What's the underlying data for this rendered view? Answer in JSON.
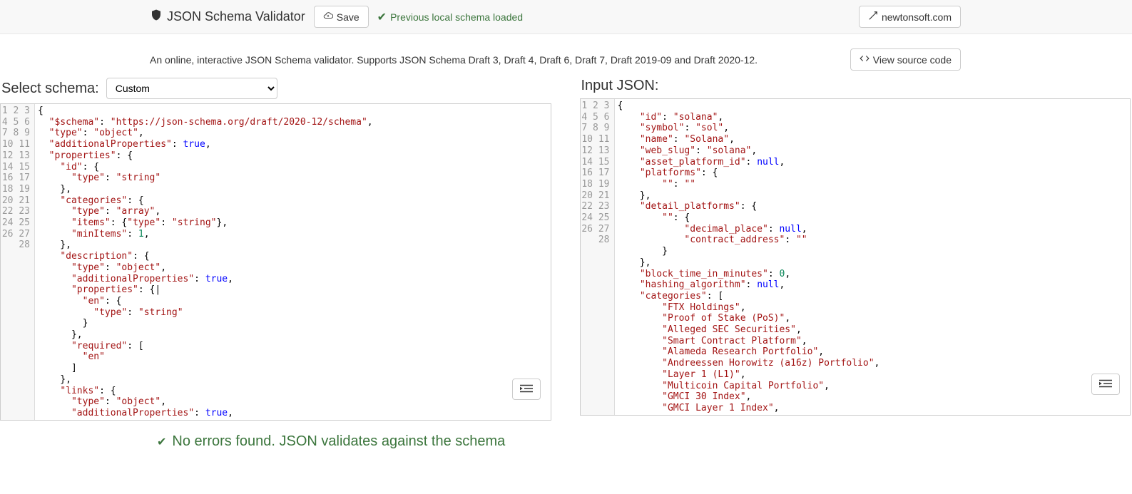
{
  "header": {
    "title": "JSON Schema Validator",
    "save_label": "Save",
    "status_loaded": "Previous local schema loaded",
    "newtonsoft_label": "newtonsoft.com"
  },
  "subheader": {
    "description": "An online, interactive JSON Schema validator. Supports JSON Schema Draft 3, Draft 4, Draft 6, Draft 7, Draft 2019-09 and Draft 2020-12.",
    "view_source_label": "View source code"
  },
  "left_panel": {
    "label": "Select schema:",
    "select_value": "Custom",
    "lines": [
      [
        [
          "punc",
          "{"
        ]
      ],
      [
        [
          "punc",
          "  "
        ],
        [
          "key",
          "\"$schema\""
        ],
        [
          "punc",
          ": "
        ],
        [
          "str",
          "\"https://json-schema.org/draft/2020-12/schema\""
        ],
        [
          "punc",
          ","
        ]
      ],
      [
        [
          "punc",
          "  "
        ],
        [
          "key",
          "\"type\""
        ],
        [
          "punc",
          ": "
        ],
        [
          "str",
          "\"object\""
        ],
        [
          "punc",
          ","
        ]
      ],
      [
        [
          "punc",
          "  "
        ],
        [
          "key",
          "\"additionalProperties\""
        ],
        [
          "punc",
          ": "
        ],
        [
          "bool",
          "true"
        ],
        [
          "punc",
          ","
        ]
      ],
      [
        [
          "punc",
          "  "
        ],
        [
          "key",
          "\"properties\""
        ],
        [
          "punc",
          ": {"
        ]
      ],
      [
        [
          "punc",
          "    "
        ],
        [
          "key",
          "\"id\""
        ],
        [
          "punc",
          ": {"
        ]
      ],
      [
        [
          "punc",
          "      "
        ],
        [
          "key",
          "\"type\""
        ],
        [
          "punc",
          ": "
        ],
        [
          "str",
          "\"string\""
        ]
      ],
      [
        [
          "punc",
          "    },"
        ]
      ],
      [
        [
          "punc",
          "    "
        ],
        [
          "key",
          "\"categories\""
        ],
        [
          "punc",
          ": {"
        ]
      ],
      [
        [
          "punc",
          "      "
        ],
        [
          "key",
          "\"type\""
        ],
        [
          "punc",
          ": "
        ],
        [
          "str",
          "\"array\""
        ],
        [
          "punc",
          ","
        ]
      ],
      [
        [
          "punc",
          "      "
        ],
        [
          "key",
          "\"items\""
        ],
        [
          "punc",
          ": {"
        ],
        [
          "key",
          "\"type\""
        ],
        [
          "punc",
          ": "
        ],
        [
          "str",
          "\"string\""
        ],
        [
          "punc",
          "},"
        ]
      ],
      [
        [
          "punc",
          "      "
        ],
        [
          "key",
          "\"minItems\""
        ],
        [
          "punc",
          ": "
        ],
        [
          "num",
          "1"
        ],
        [
          "punc",
          ","
        ]
      ],
      [
        [
          "punc",
          "    },"
        ]
      ],
      [
        [
          "punc",
          "    "
        ],
        [
          "key",
          "\"description\""
        ],
        [
          "punc",
          ": {"
        ]
      ],
      [
        [
          "punc",
          "      "
        ],
        [
          "key",
          "\"type\""
        ],
        [
          "punc",
          ": "
        ],
        [
          "str",
          "\"object\""
        ],
        [
          "punc",
          ","
        ]
      ],
      [
        [
          "punc",
          "      "
        ],
        [
          "key",
          "\"additionalProperties\""
        ],
        [
          "punc",
          ": "
        ],
        [
          "bool",
          "true"
        ],
        [
          "punc",
          ","
        ]
      ],
      [
        [
          "punc",
          "      "
        ],
        [
          "key",
          "\"properties\""
        ],
        [
          "punc",
          ": {|"
        ]
      ],
      [
        [
          "punc",
          "        "
        ],
        [
          "key",
          "\"en\""
        ],
        [
          "punc",
          ": {"
        ]
      ],
      [
        [
          "punc",
          "          "
        ],
        [
          "key",
          "\"type\""
        ],
        [
          "punc",
          ": "
        ],
        [
          "str",
          "\"string\""
        ]
      ],
      [
        [
          "punc",
          "        }"
        ]
      ],
      [
        [
          "punc",
          "      },"
        ]
      ],
      [
        [
          "punc",
          "      "
        ],
        [
          "key",
          "\"required\""
        ],
        [
          "punc",
          ": ["
        ]
      ],
      [
        [
          "punc",
          "        "
        ],
        [
          "str",
          "\"en\""
        ]
      ],
      [
        [
          "punc",
          "      ]"
        ]
      ],
      [
        [
          "punc",
          "    },"
        ]
      ],
      [
        [
          "punc",
          "    "
        ],
        [
          "key",
          "\"links\""
        ],
        [
          "punc",
          ": {"
        ]
      ],
      [
        [
          "punc",
          "      "
        ],
        [
          "key",
          "\"type\""
        ],
        [
          "punc",
          ": "
        ],
        [
          "str",
          "\"object\""
        ],
        [
          "punc",
          ","
        ]
      ],
      [
        [
          "punc",
          "      "
        ],
        [
          "key",
          "\"additionalProperties\""
        ],
        [
          "punc",
          ": "
        ],
        [
          "bool",
          "true"
        ],
        [
          "punc",
          ","
        ]
      ]
    ]
  },
  "right_panel": {
    "label": "Input JSON:",
    "lines": [
      [
        [
          "punc",
          "{"
        ]
      ],
      [
        [
          "punc",
          "    "
        ],
        [
          "key",
          "\"id\""
        ],
        [
          "punc",
          ": "
        ],
        [
          "str",
          "\"solana\""
        ],
        [
          "punc",
          ","
        ]
      ],
      [
        [
          "punc",
          "    "
        ],
        [
          "key",
          "\"symbol\""
        ],
        [
          "punc",
          ": "
        ],
        [
          "str",
          "\"sol\""
        ],
        [
          "punc",
          ","
        ]
      ],
      [
        [
          "punc",
          "    "
        ],
        [
          "key",
          "\"name\""
        ],
        [
          "punc",
          ": "
        ],
        [
          "str",
          "\"Solana\""
        ],
        [
          "punc",
          ","
        ]
      ],
      [
        [
          "punc",
          "    "
        ],
        [
          "key",
          "\"web_slug\""
        ],
        [
          "punc",
          ": "
        ],
        [
          "str",
          "\"solana\""
        ],
        [
          "punc",
          ","
        ]
      ],
      [
        [
          "punc",
          "    "
        ],
        [
          "key",
          "\"asset_platform_id\""
        ],
        [
          "punc",
          ": "
        ],
        [
          "null",
          "null"
        ],
        [
          "punc",
          ","
        ]
      ],
      [
        [
          "punc",
          "    "
        ],
        [
          "key",
          "\"platforms\""
        ],
        [
          "punc",
          ": {"
        ]
      ],
      [
        [
          "punc",
          "        "
        ],
        [
          "key",
          "\"\""
        ],
        [
          "punc",
          ": "
        ],
        [
          "str",
          "\"\""
        ]
      ],
      [
        [
          "punc",
          "    },"
        ]
      ],
      [
        [
          "punc",
          "    "
        ],
        [
          "key",
          "\"detail_platforms\""
        ],
        [
          "punc",
          ": {"
        ]
      ],
      [
        [
          "punc",
          "        "
        ],
        [
          "key",
          "\"\""
        ],
        [
          "punc",
          ": {"
        ]
      ],
      [
        [
          "punc",
          "            "
        ],
        [
          "key",
          "\"decimal_place\""
        ],
        [
          "punc",
          ": "
        ],
        [
          "null",
          "null"
        ],
        [
          "punc",
          ","
        ]
      ],
      [
        [
          "punc",
          "            "
        ],
        [
          "key",
          "\"contract_address\""
        ],
        [
          "punc",
          ": "
        ],
        [
          "str",
          "\"\""
        ]
      ],
      [
        [
          "punc",
          "        }"
        ]
      ],
      [
        [
          "punc",
          "    },"
        ]
      ],
      [
        [
          "punc",
          "    "
        ],
        [
          "key",
          "\"block_time_in_minutes\""
        ],
        [
          "punc",
          ": "
        ],
        [
          "num",
          "0"
        ],
        [
          "punc",
          ","
        ]
      ],
      [
        [
          "punc",
          "    "
        ],
        [
          "key",
          "\"hashing_algorithm\""
        ],
        [
          "punc",
          ": "
        ],
        [
          "null",
          "null"
        ],
        [
          "punc",
          ","
        ]
      ],
      [
        [
          "punc",
          "    "
        ],
        [
          "key",
          "\"categories\""
        ],
        [
          "punc",
          ": ["
        ]
      ],
      [
        [
          "punc",
          "        "
        ],
        [
          "str",
          "\"FTX Holdings\""
        ],
        [
          "punc",
          ","
        ]
      ],
      [
        [
          "punc",
          "        "
        ],
        [
          "str",
          "\"Proof of Stake (PoS)\""
        ],
        [
          "punc",
          ","
        ]
      ],
      [
        [
          "punc",
          "        "
        ],
        [
          "str",
          "\"Alleged SEC Securities\""
        ],
        [
          "punc",
          ","
        ]
      ],
      [
        [
          "punc",
          "        "
        ],
        [
          "str",
          "\"Smart Contract Platform\""
        ],
        [
          "punc",
          ","
        ]
      ],
      [
        [
          "punc",
          "        "
        ],
        [
          "str",
          "\"Alameda Research Portfolio\""
        ],
        [
          "punc",
          ","
        ]
      ],
      [
        [
          "punc",
          "        "
        ],
        [
          "str",
          "\"Andreessen Horowitz (a16z) Portfolio\""
        ],
        [
          "punc",
          ","
        ]
      ],
      [
        [
          "punc",
          "        "
        ],
        [
          "str",
          "\"Layer 1 (L1)\""
        ],
        [
          "punc",
          ","
        ]
      ],
      [
        [
          "punc",
          "        "
        ],
        [
          "str",
          "\"Multicoin Capital Portfolio\""
        ],
        [
          "punc",
          ","
        ]
      ],
      [
        [
          "punc",
          "        "
        ],
        [
          "str",
          "\"GMCI 30 Index\""
        ],
        [
          "punc",
          ","
        ]
      ],
      [
        [
          "punc",
          "        "
        ],
        [
          "str",
          "\"GMCI Layer 1 Index\""
        ],
        [
          "punc",
          ","
        ]
      ]
    ]
  },
  "result": {
    "message": "No errors found. JSON validates against the schema"
  }
}
